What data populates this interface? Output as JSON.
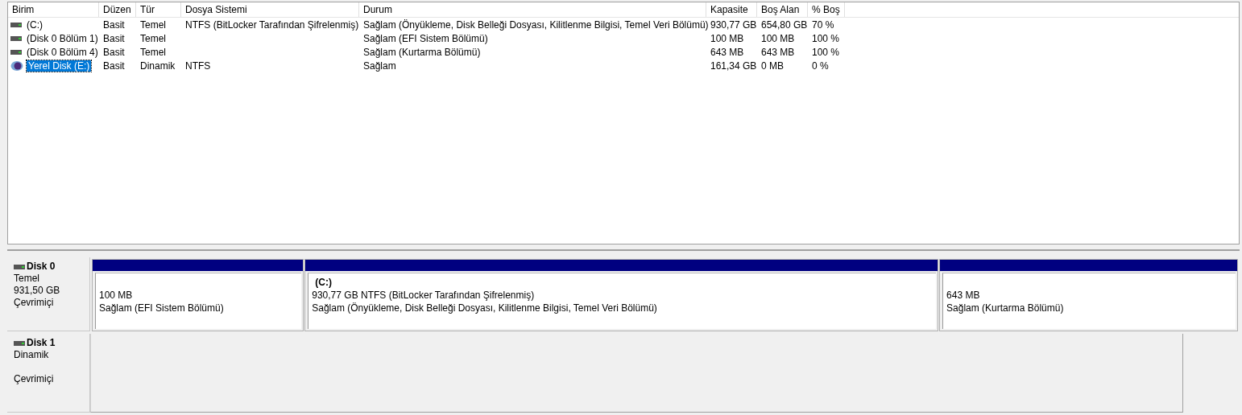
{
  "volume_list": {
    "columns": [
      "Birim",
      "Düzen",
      "Tür",
      "Dosya Sistemi",
      "Durum",
      "Kapasite",
      "Boş Alan",
      "% Boş"
    ],
    "rows": [
      {
        "kind": "basic",
        "selected": false,
        "cells": [
          "(C:)",
          "Basit",
          "Temel",
          "NTFS (BitLocker Tarafından Şifrelenmiş)",
          "Sağlam (Önyükleme, Disk Belleği Dosyası, Kilitlenme Bilgisi, Temel Veri Bölümü)",
          "930,77 GB",
          "654,80 GB",
          "70 %"
        ]
      },
      {
        "kind": "basic",
        "selected": false,
        "cells": [
          "(Disk 0 Bölüm 1)",
          "Basit",
          "Temel",
          "",
          "Sağlam (EFI Sistem Bölümü)",
          "100 MB",
          "100 MB",
          "100 %"
        ]
      },
      {
        "kind": "basic",
        "selected": false,
        "cells": [
          "(Disk 0 Bölüm 4)",
          "Basit",
          "Temel",
          "",
          "Sağlam (Kurtarma Bölümü)",
          "643 MB",
          "643 MB",
          "100 %"
        ]
      },
      {
        "kind": "dynamic",
        "selected": true,
        "cells": [
          "Yerel Disk (E:)",
          "Basit",
          "Dinamik",
          "NTFS",
          "Sağlam",
          "161,34 GB",
          "0 MB",
          "0 %"
        ]
      }
    ]
  },
  "disks": [
    {
      "name": "Disk 0",
      "type": "Temel",
      "size": "931,50 GB",
      "status": "Çevrimiçi",
      "partitions": [
        {
          "line1": "100 MB",
          "line2": "Sağlam (EFI Sistem Bölümü)"
        },
        {
          "title": "(C:)",
          "line1": "930,77 GB NTFS (BitLocker Tarafından Şifrelenmiş)",
          "line2": "Sağlam (Önyükleme, Disk Belleği Dosyası, Kilitlenme Bilgisi, Temel Veri Bölümü)"
        },
        {
          "line1": "643 MB",
          "line2": "Sağlam (Kurtarma Bölümü)"
        }
      ]
    },
    {
      "name": "Disk 1",
      "type": "Dinamik",
      "status": "Çevrimiçi"
    }
  ]
}
